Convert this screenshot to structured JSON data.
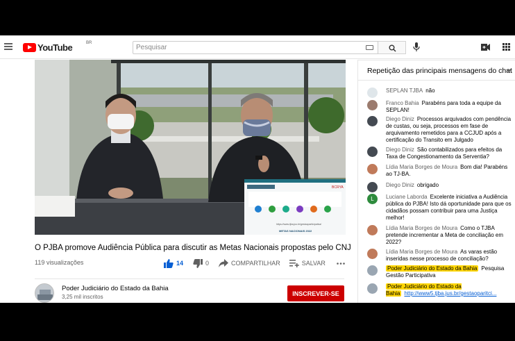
{
  "header": {
    "logo_text": "YouTube",
    "country": "BR",
    "search_placeholder": "Pesquisar"
  },
  "video": {
    "title": "O PJBA promove Audiência Pública para discutir as Metas Nacionais propostas pelo CNJ",
    "views": "119 visualizações",
    "likes": "14",
    "dislikes": "0",
    "share_label": "COMPARTILHAR",
    "save_label": "SALVAR",
    "slide_url": "https://www.tjba.jus.br/gestaoparticipativa/",
    "slide_footer": "METAS NACIONAIS 2022",
    "slide_logo": "BCRYA"
  },
  "channel": {
    "name": "Poder Judiciário do Estado da Bahia",
    "subscribers": "3,25 mil inscritos",
    "subscribe_label": "INSCREVER-SE"
  },
  "chat": {
    "header": "Repetição das principais mensagens do chat",
    "messages": [
      {
        "author": "SEPLAN TJBA",
        "text": "não",
        "avatar": "#dfe6ea"
      },
      {
        "author": "Franco Bahia",
        "text": "Parabéns para toda a equipe da SEPLAN!",
        "avatar": "#9b7b6e"
      },
      {
        "author": "Diego Diniz",
        "text": "Processos arquivados com pendência de custas, ou seja, processos em fase de arquivamento remetidos para a CCJUD após a certificação do Transito em Julgado",
        "avatar": "#444a52"
      },
      {
        "author": "Diego Diniz",
        "text": "São contabilizados para efeitos da Taxa de Congestionamento da Serventia?",
        "avatar": "#444a52"
      },
      {
        "author": "Lídia Maria Borges de Moura",
        "text": "Bom dia! Parabéns ao TJ-BA.",
        "avatar": "#c07a5a"
      },
      {
        "author": "Diego Diniz",
        "text": "obrigado",
        "avatar": "#444a52"
      },
      {
        "author": "Luciane Laborda",
        "text": "Excelente iniciativa a Audiência pública do PJBA! Isto dá oportunidade para que os cidadãos possam contribuir para uma Justiça melhor!",
        "avatar": "#2e8b3d",
        "initial": "L"
      },
      {
        "author": "Lídia Maria Borges de Moura",
        "text": "Como o TJBA pretende incrementar a Meta de conciliação em 2022?",
        "avatar": "#c07a5a"
      },
      {
        "author": "Lídia Maria Borges de Moura",
        "text": "As varas estão inseridas nesse processo de conciliação?",
        "avatar": "#c07a5a"
      },
      {
        "author": "Poder Judiciário do Estado da Bahia",
        "text": "Pesquisa Gestão Participativa",
        "avatar": "#9aa6b2"
      },
      {
        "author": "Poder Judiciário do Estado da Bahia",
        "text": "http://www5.tjba.jus.br/gestaoparitci...",
        "avatar": "#9aa6b2"
      }
    ]
  }
}
